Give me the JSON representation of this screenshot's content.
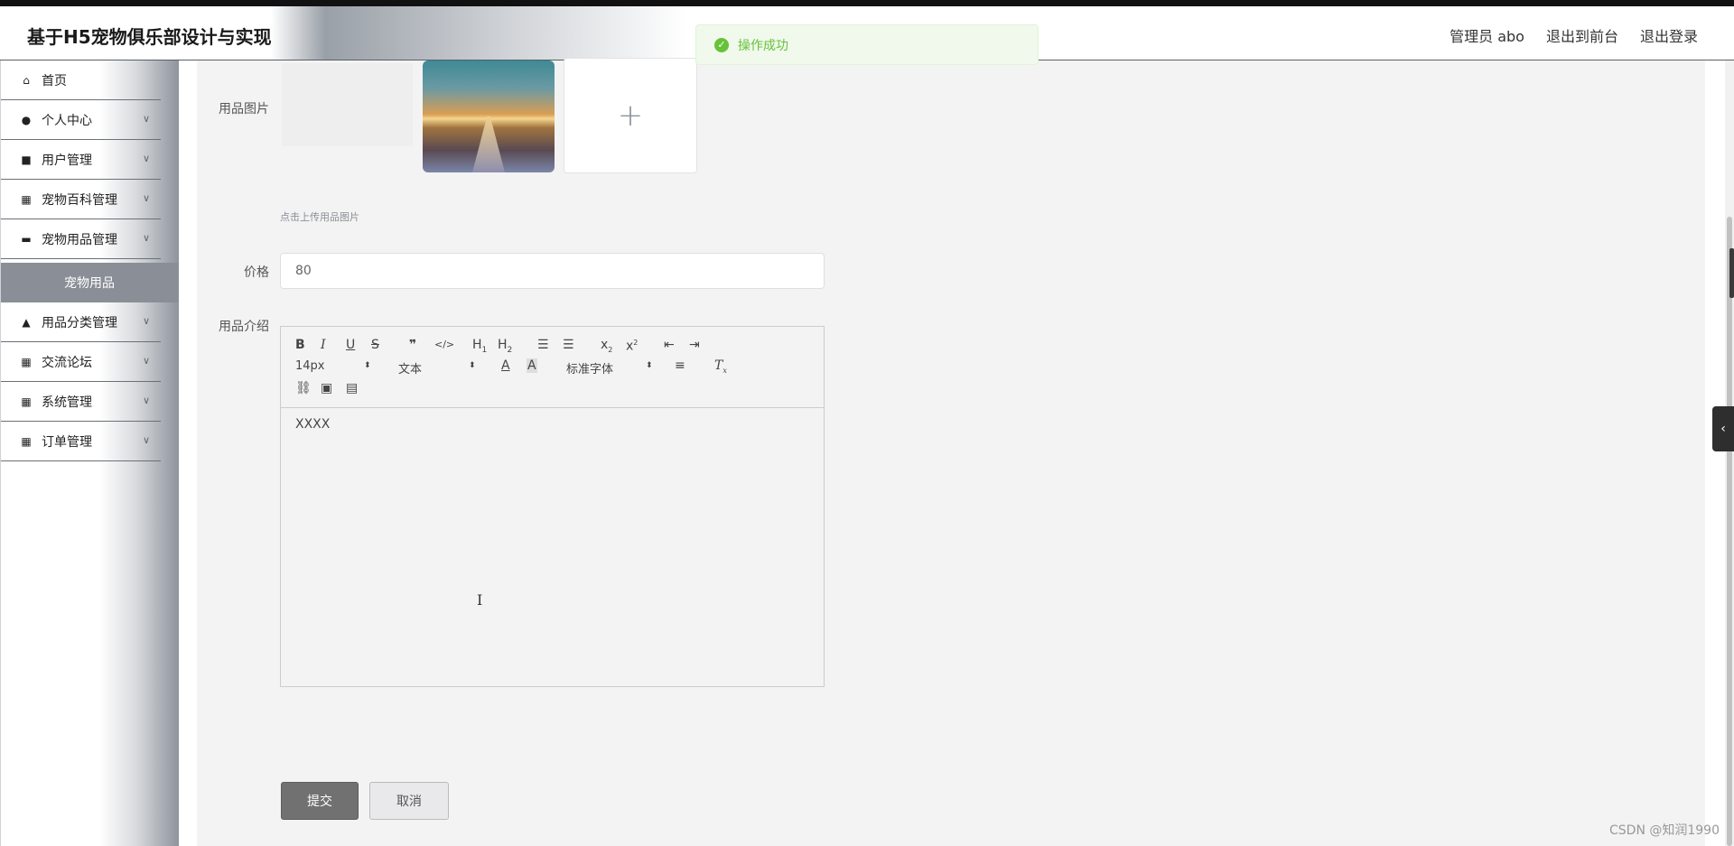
{
  "header": {
    "title": "基于H5宠物俱乐部设计与实现",
    "admin_label": "管理员 abo",
    "to_front_label": "退出到前台",
    "logout_label": "退出登录"
  },
  "toast": {
    "message": "操作成功",
    "color": "#67c23a"
  },
  "sidebar": {
    "items": [
      {
        "label": "首页",
        "icon": "home-icon",
        "glyph": "⌂",
        "has_arrow": false
      },
      {
        "label": "个人中心",
        "icon": "user-icon",
        "glyph": "●",
        "has_arrow": true
      },
      {
        "label": "用户管理",
        "icon": "users-icon",
        "glyph": "■",
        "has_arrow": true
      },
      {
        "label": "宠物百科管理",
        "icon": "grid-icon",
        "glyph": "▦",
        "has_arrow": true
      },
      {
        "label": "宠物用品管理",
        "icon": "briefcase-icon",
        "glyph": "▬",
        "has_arrow": true
      },
      {
        "label": "用品分类管理",
        "icon": "person-icon",
        "glyph": "▲",
        "has_arrow": true
      },
      {
        "label": "交流论坛",
        "icon": "grid-icon",
        "glyph": "▦",
        "has_arrow": true
      },
      {
        "label": "系统管理",
        "icon": "grid-icon",
        "glyph": "▦",
        "has_arrow": true
      },
      {
        "label": "订单管理",
        "icon": "grid-icon",
        "glyph": "▦",
        "has_arrow": true
      }
    ],
    "active_submenu": "宠物用品"
  },
  "form": {
    "image_label": "用品图片",
    "upload_tip": "点击上传用品图片",
    "price_label": "价格",
    "price_value": "80",
    "intro_label": "用品介绍",
    "editor": {
      "font_size": "14px",
      "block_type": "文本",
      "font_family": "标准字体",
      "content": "XXXX"
    },
    "submit_label": "提交",
    "cancel_label": "取消"
  },
  "watermark": "CSDN @知润1990"
}
